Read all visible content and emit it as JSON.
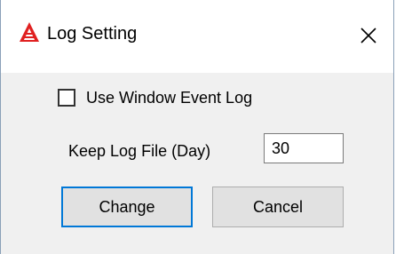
{
  "window": {
    "title": "Log Setting",
    "app_icon": "red-stacked-a-logo-icon",
    "close_icon": "close-x-icon"
  },
  "options": {
    "use_event_log_label": "Use Window Event Log",
    "use_event_log_checked": false
  },
  "keep_log": {
    "label": "Keep Log File (Day)",
    "value": "30"
  },
  "buttons": {
    "change_label": "Change",
    "cancel_label": "Cancel"
  },
  "colors": {
    "title_background": "#ffffff",
    "client_background": "#f0f0f0",
    "button_background": "#e1e1e1",
    "focus_border": "#0078d7",
    "icon_red": "#e02020"
  }
}
